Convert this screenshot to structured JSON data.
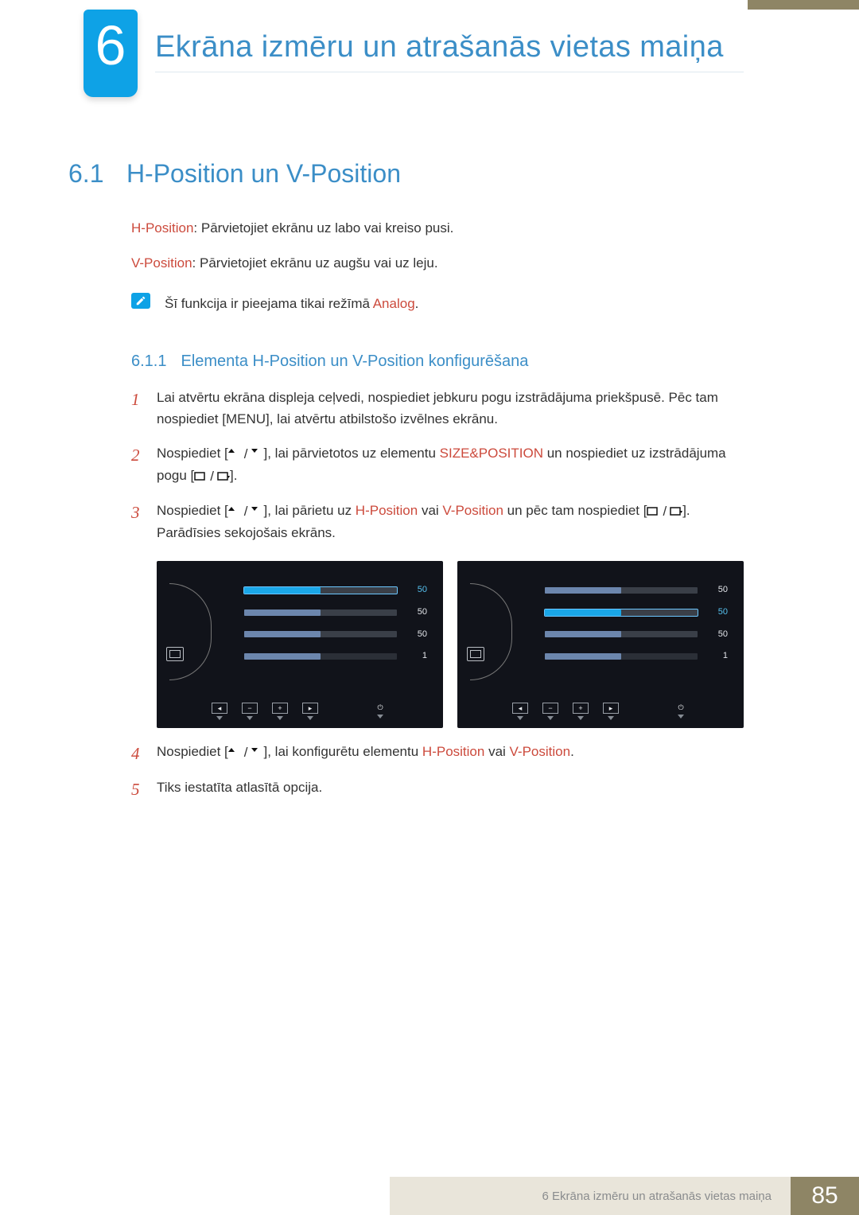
{
  "chapter": {
    "number": "6",
    "title": "Ekrāna izmēru un atrašanās vietas maiņa"
  },
  "section": {
    "number": "6.1",
    "title": "H-Position un V-Position"
  },
  "intro": {
    "h_label": "H-Position",
    "h_text": ": Pārvietojiet ekrānu uz labo vai kreiso pusi.",
    "v_label": "V-Position",
    "v_text": ": Pārvietojiet ekrānu uz augšu vai uz leju.",
    "note_pre": "Šī funkcija ir pieejama tikai režīmā ",
    "note_hi": "Analog",
    "note_post": "."
  },
  "sub": {
    "number": "6.1.1",
    "title": "Elementa H-Position un V-Position konfigurēšana"
  },
  "steps": {
    "s1": "Lai atvērtu ekrāna displeja ceļvedi, nospiediet jebkuru pogu izstrādājuma priekšpusē. Pēc tam nospiediet [MENU], lai atvērtu atbilstošo izvēlnes ekrānu.",
    "s2a": "Nospiediet [",
    "s2b": "], lai pārvietotos uz elementu ",
    "s2_size": "SIZE&POSITION",
    "s2c": " un nospiediet uz izstrādājuma pogu [",
    "s2d": "].",
    "s3a": "Nospiediet [",
    "s3b": "], lai pārietu uz ",
    "s3_h": "H-Position",
    "s3_or": " vai ",
    "s3_v": "V-Position",
    "s3c": " un pēc tam nospiediet [",
    "s3d": "]. Parādīsies sekojošais ekrāns.",
    "s4a": "Nospiediet [",
    "s4b": "], lai konfigurētu elementu ",
    "s4_h": "H-Position",
    "s4_or": " vai ",
    "s4_v": "V-Position",
    "s4c": ".",
    "s5": "Tiks iestatīta atlasītā opcija."
  },
  "osd": {
    "rows": [
      {
        "val": "50"
      },
      {
        "val": "50"
      },
      {
        "val": "50"
      },
      {
        "val": "1"
      }
    ],
    "bottom": [
      "◂",
      "−",
      "+",
      "▸",
      "",
      "⏻"
    ]
  },
  "footer": {
    "label": "6 Ekrāna izmēru un atrašanās vietas maiņa",
    "page": "85"
  }
}
